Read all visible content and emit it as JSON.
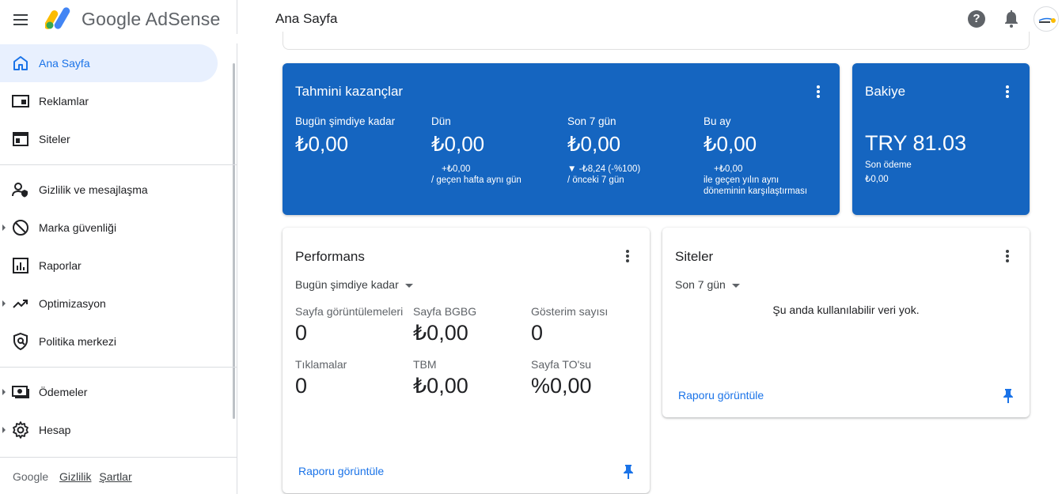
{
  "header": {
    "brand": "Google AdSense",
    "page_title": "Ana Sayfa",
    "help_icon": "?"
  },
  "sidebar": {
    "items": [
      {
        "label": "Ana Sayfa",
        "icon": "home-icon",
        "active": true
      },
      {
        "label": "Reklamlar",
        "icon": "ads-icon"
      },
      {
        "label": "Siteler",
        "icon": "sites-icon"
      },
      {
        "label": "Gizlilik ve mesajlaşma",
        "icon": "privacy-user-icon"
      },
      {
        "label": "Marka güvenliği",
        "icon": "block-icon"
      },
      {
        "label": "Raporlar",
        "icon": "bar-chart-icon"
      },
      {
        "label": "Optimizasyon",
        "icon": "trending-up-icon"
      },
      {
        "label": "Politika merkezi",
        "icon": "shield-icon"
      },
      {
        "label": "Ödemeler",
        "icon": "payments-icon"
      },
      {
        "label": "Hesap",
        "icon": "gear-icon"
      }
    ],
    "footer": {
      "google": "Google",
      "privacy": "Gizlilik",
      "terms": "Şartlar"
    }
  },
  "earnings": {
    "title": "Tahmini kazançlar",
    "columns": [
      {
        "label": "Bugün şimdiye kadar",
        "value": "₺0,00",
        "sub1": "",
        "sub2": ""
      },
      {
        "label": "Dün",
        "value": "₺0,00",
        "sub1": "+₺0,00",
        "sub2": "/ geçen hafta aynı gün"
      },
      {
        "label": "Son 7 gün",
        "value": "₺0,00",
        "sub1": "▼ -₺8,24 (-%100)",
        "sub2": "/ önceki 7 gün"
      },
      {
        "label": "Bu ay",
        "value": "₺0,00",
        "sub1": "+₺0,00",
        "sub2": "ile geçen yılın aynı",
        "sub3": "döneminin karşılaştırması"
      }
    ]
  },
  "balance": {
    "title": "Bakiye",
    "value": "TRY 81.03",
    "last_payment_label": "Son ödeme",
    "last_payment_value": "₺0,00"
  },
  "performance": {
    "title": "Performans",
    "period": "Bugün şimdiye kadar",
    "metrics": [
      {
        "label": "Sayfa görüntülemeleri",
        "value": "0"
      },
      {
        "label": "Sayfa BGBG",
        "value": "₺0,00"
      },
      {
        "label": "Gösterim sayısı",
        "value": "0"
      },
      {
        "label": "Tıklamalar",
        "value": "0"
      },
      {
        "label": "TBM",
        "value": "₺0,00"
      },
      {
        "label": "Sayfa TO'su",
        "value": "%0,00"
      }
    ],
    "report_link": "Raporu görüntüle"
  },
  "sites": {
    "title": "Siteler",
    "period": "Son 7 gün",
    "empty_message": "Şu anda kullanılabilir veri yok.",
    "report_link": "Raporu görüntüle"
  },
  "colors": {
    "accent": "#1a73e8",
    "card_blue": "#1565c0",
    "active_nav_bg": "#e8f0fe"
  }
}
